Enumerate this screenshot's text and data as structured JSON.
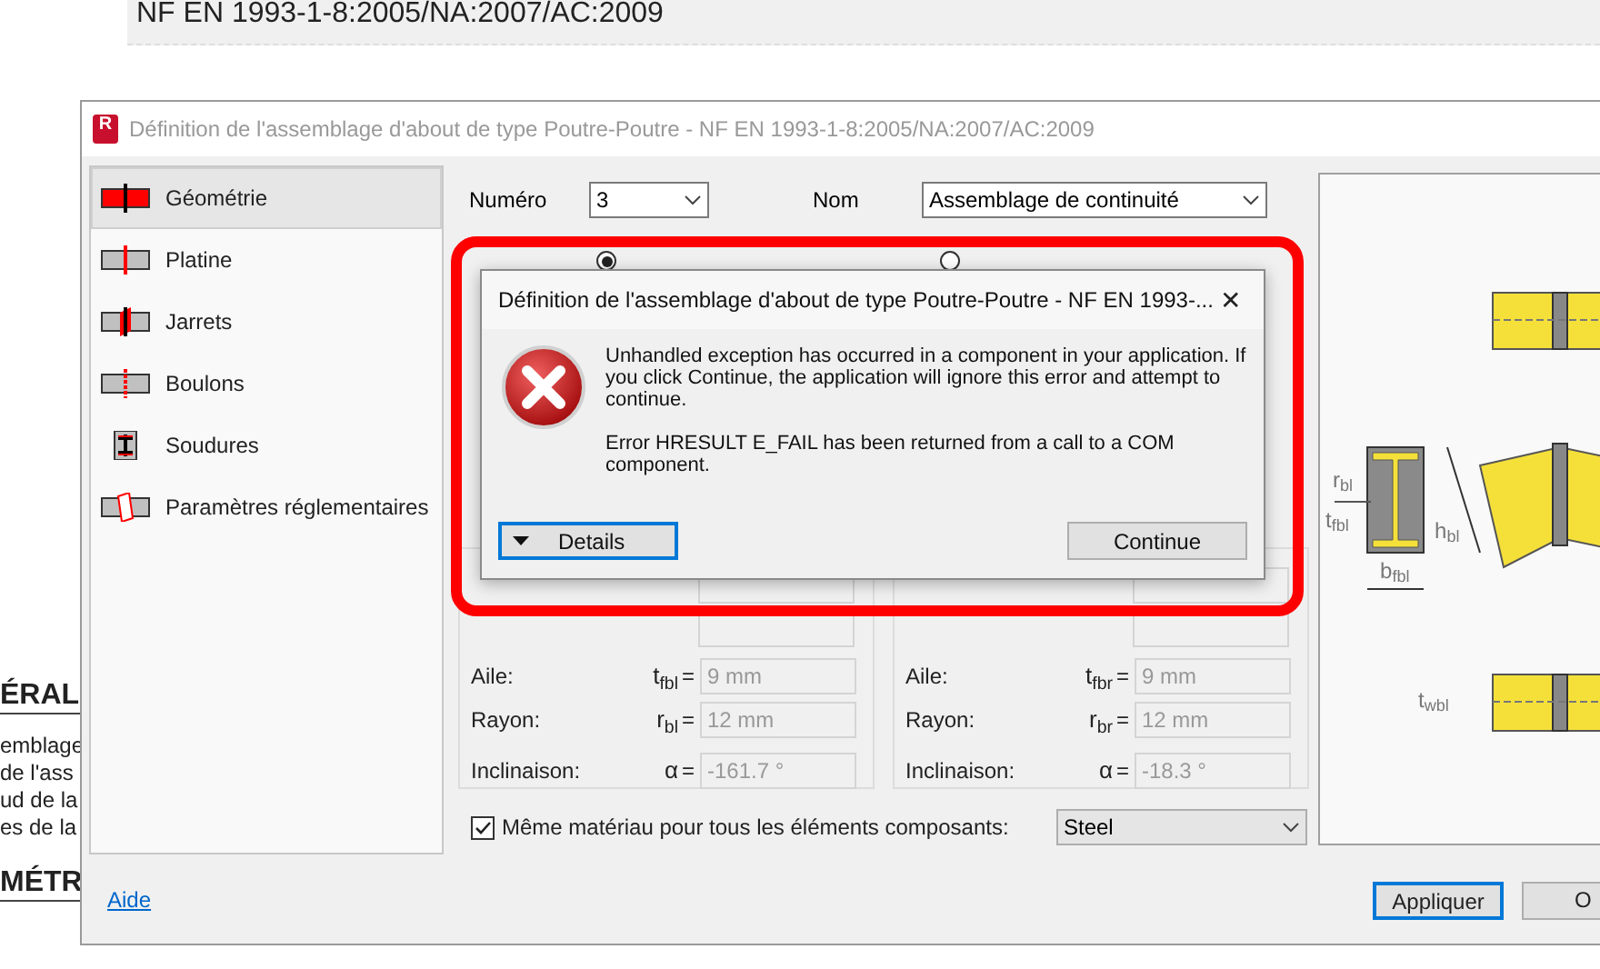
{
  "background_page": {
    "standard": "NF EN 1993-1-8:2005/NA:2007/AC:2009",
    "left_fragments": [
      {
        "kind": "heading",
        "text": "ÉRAL"
      },
      {
        "kind": "line",
        "text": "emblage"
      },
      {
        "kind": "line",
        "text": "de l'ass"
      },
      {
        "kind": "line",
        "text": "ud de la"
      },
      {
        "kind": "line",
        "text": "es de la"
      },
      {
        "kind": "heading",
        "text": "MÉTR"
      }
    ]
  },
  "dialog": {
    "app_icon_letter": "R",
    "title": "Définition de l'assemblage d'about de type Poutre-Poutre - NF EN 1993-1-8:2005/NA:2007/AC:2009",
    "nav": [
      {
        "kind": "geometry",
        "label": "Géométrie",
        "selected": true
      },
      {
        "kind": "plate",
        "label": "Platine",
        "selected": false
      },
      {
        "kind": "haunch",
        "label": "Jarrets",
        "selected": false
      },
      {
        "kind": "bolts",
        "label": "Boulons",
        "selected": false
      },
      {
        "kind": "welds",
        "label": "Soudures",
        "selected": false
      },
      {
        "kind": "code",
        "label": "Paramètres réglementaires",
        "selected": false
      }
    ],
    "numero": {
      "label": "Numéro",
      "value": "3"
    },
    "nom": {
      "label": "Nom",
      "value": "Assemblage de continuité"
    },
    "connection_type": [
      {
        "selected": true
      },
      {
        "selected": false
      }
    ],
    "groups": [
      {
        "rows": [
          {
            "kind": "covered"
          },
          {
            "kind": "covered"
          },
          {
            "kind": "field",
            "label": "Aile:",
            "symbol": "t$_{fbl}$",
            "equals": "=",
            "value": "9 mm",
            "disabled": true
          },
          {
            "kind": "field",
            "label": "Rayon:",
            "symbol": "r$_{bl}$",
            "equals": "=",
            "value": "12 mm",
            "disabled": true
          },
          {
            "kind": "field",
            "label": "Inclinaison:",
            "symbol": "α",
            "equals": "=",
            "value": "-161.7 °",
            "disabled": true
          }
        ]
      },
      {
        "rows": [
          {
            "kind": "covered"
          },
          {
            "kind": "covered"
          },
          {
            "kind": "field",
            "label": "Aile:",
            "symbol": "t$_{fbr}$",
            "equals": "=",
            "value": "9 mm",
            "disabled": true
          },
          {
            "kind": "field",
            "label": "Rayon:",
            "symbol": "r$_{br}$",
            "equals": "=",
            "value": "12 mm",
            "disabled": true
          },
          {
            "kind": "field",
            "label": "Inclinaison:",
            "symbol": "α",
            "equals": "=",
            "value": "-18.3 °",
            "disabled": true
          }
        ]
      }
    ],
    "same_material": {
      "label": "Même matériau pour tous les éléments composants:",
      "checked": true,
      "value": "Steel"
    },
    "drawing_labels": [
      "r$_{bl}$",
      "t$_{fbl}$",
      "h$_{bl}$",
      "b$_{fbl}$",
      "t$_{wbl}$"
    ],
    "help_link": "Aide",
    "buttons": [
      {
        "label": "Appliquer",
        "focused": true
      },
      {
        "label": "O",
        "focused": false
      }
    ]
  },
  "error_dialog": {
    "title": "Définition de l'assemblage d'about de type Poutre-Poutre - NF EN 1993-...",
    "close": "✕",
    "paragraphs": [
      "Unhandled exception has occurred in a component in your application. If you click Continue, the application will ignore this error and attempt to continue.",
      "Error HRESULT E_FAIL has been returned from a call to a COM component."
    ],
    "details_button": {
      "label": "Details",
      "focused": true
    },
    "continue_button": {
      "label": "Continue",
      "focused": false
    }
  }
}
